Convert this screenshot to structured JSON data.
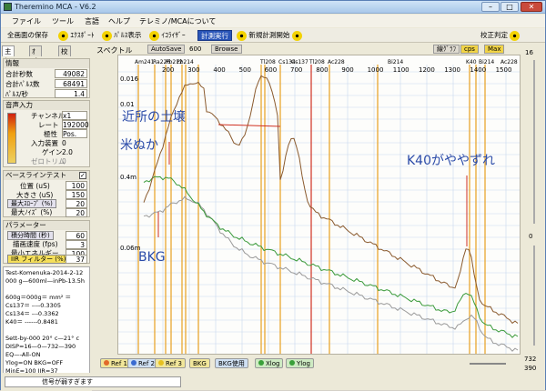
{
  "title": "Theremino MCA - V6.2",
  "window_buttons": {
    "min": "–",
    "max": "□",
    "close": "✕"
  },
  "menu": [
    "ファイル",
    "ツール",
    "言語",
    "ヘルプ",
    "テレミノ/MCAについて"
  ],
  "toolbar": {
    "save_screen": "全画面の保存",
    "export": "ｴｸｽﾎﾟｰﾄ",
    "pulse_display": "ﾊﾟﾙｽ表示",
    "equalizer": "ｲｺﾗｲｻﾞｰ",
    "measure_run": "計測実行",
    "new_measure": "新規計測開始",
    "calibration": "校正判定"
  },
  "tabs": [
    "主設定",
    "ｵﾌﾟｼｮﾝ",
    "校正設定"
  ],
  "info": {
    "header": "情報",
    "rows": [
      {
        "label": "合計秒数",
        "value": "49082"
      },
      {
        "label": "合計ﾊﾟﾙｽ数",
        "value": "68491"
      },
      {
        "label": "ﾊﾟﾙｽ/秒",
        "value": "1.4"
      }
    ]
  },
  "audio": {
    "header": "音声入力",
    "rows": [
      {
        "label": "チャンネル",
        "value": "x1"
      },
      {
        "label": "レート",
        "value": "192000"
      },
      {
        "label": "極性",
        "value": "Pos."
      },
      {
        "label": "入力装置",
        "value": "0"
      },
      {
        "label": "ゲイン",
        "value": "2.0"
      },
      {
        "label": "ゼロトリム",
        "value": "0"
      }
    ]
  },
  "baseline": {
    "header": "ベースラインテスト",
    "rows": [
      {
        "label": "位置 (uS)",
        "value": "100"
      },
      {
        "label": "大きさ (uS)",
        "value": "150"
      },
      {
        "label": "最大ｽﾛｰﾌﾟ (%)",
        "value": "20"
      },
      {
        "label": "最大ﾉｲｽﾞ (%)",
        "value": "20"
      }
    ]
  },
  "params": {
    "header": "パラメーター",
    "rows": [
      {
        "label": "積分時間 (秒)",
        "value": "60"
      },
      {
        "label": "描画速度 (fps)",
        "value": "3"
      },
      {
        "label": "最小エネルギー",
        "value": "100"
      },
      {
        "label": "IIR フィルター (%)",
        "value": "37"
      }
    ]
  },
  "memo": [
    "Test-Komenuka-2014-2-12",
    "000 g—600ml—inPb-13.5h",
    "",
    "600g＝000g＝ mm² ＝",
    "Cs137＝ ----0.3305",
    "Cs134＝ ---0.3362",
    "K40＝ ------0.8481",
    "",
    "Sett-by-000  20° c—21° c",
    "DISP=16—0—732—390",
    "EQ—-All-ON",
    "Ylog=ON  BKG=OFF",
    "MinE=100  IIR=37"
  ],
  "status": "信号が弱すぎます",
  "spectrum": {
    "label": "スペクトル",
    "autosave": "AutoSave",
    "autosave_value": "600",
    "browse": "Browse",
    "line_graph": "線ｸﾞﾗﾌ",
    "cps": "cps",
    "max": "Max"
  },
  "plot": {
    "x_ticks": [
      "200",
      "300",
      "400",
      "500",
      "600",
      "700",
      "800",
      "900",
      "1000",
      "1100",
      "1200",
      "1300",
      "1400",
      "1500",
      "1600"
    ],
    "y_labels": [
      "0.016",
      "0.01",
      "0.4m",
      "0.06m"
    ],
    "isotopes": [
      "Am241",
      "Ra226",
      "Pb212",
      "Pb214",
      "Tl208",
      "Cs134",
      "Cs137",
      "Tl208",
      "Ac228",
      "Bi214",
      "K40",
      "Bi214",
      "Ac228"
    ],
    "annotations": {
      "soil": "近所の土壌",
      "rice_bran": "米ぬか",
      "bkg": "BKG",
      "k40": "K40がややずれ"
    }
  },
  "right_panel": {
    "top": "16",
    "mid": "0",
    "val1": "732",
    "val2": "390"
  },
  "bottom": {
    "ref1": "Ref 1",
    "ref2": "Ref 2",
    "ref3": "Ref 3",
    "bkg": "BKG",
    "bkg_use": "BKG使用",
    "xlog": "Xlog",
    "ylog": "Ylog"
  },
  "colors": {
    "soil": "#8a5a2e",
    "rice": "#3a9a3a",
    "bkg": "#9a9a9a",
    "marker_orange": "#e8a020",
    "marker_red": "#d03020",
    "grid": "#c8d8ee"
  }
}
